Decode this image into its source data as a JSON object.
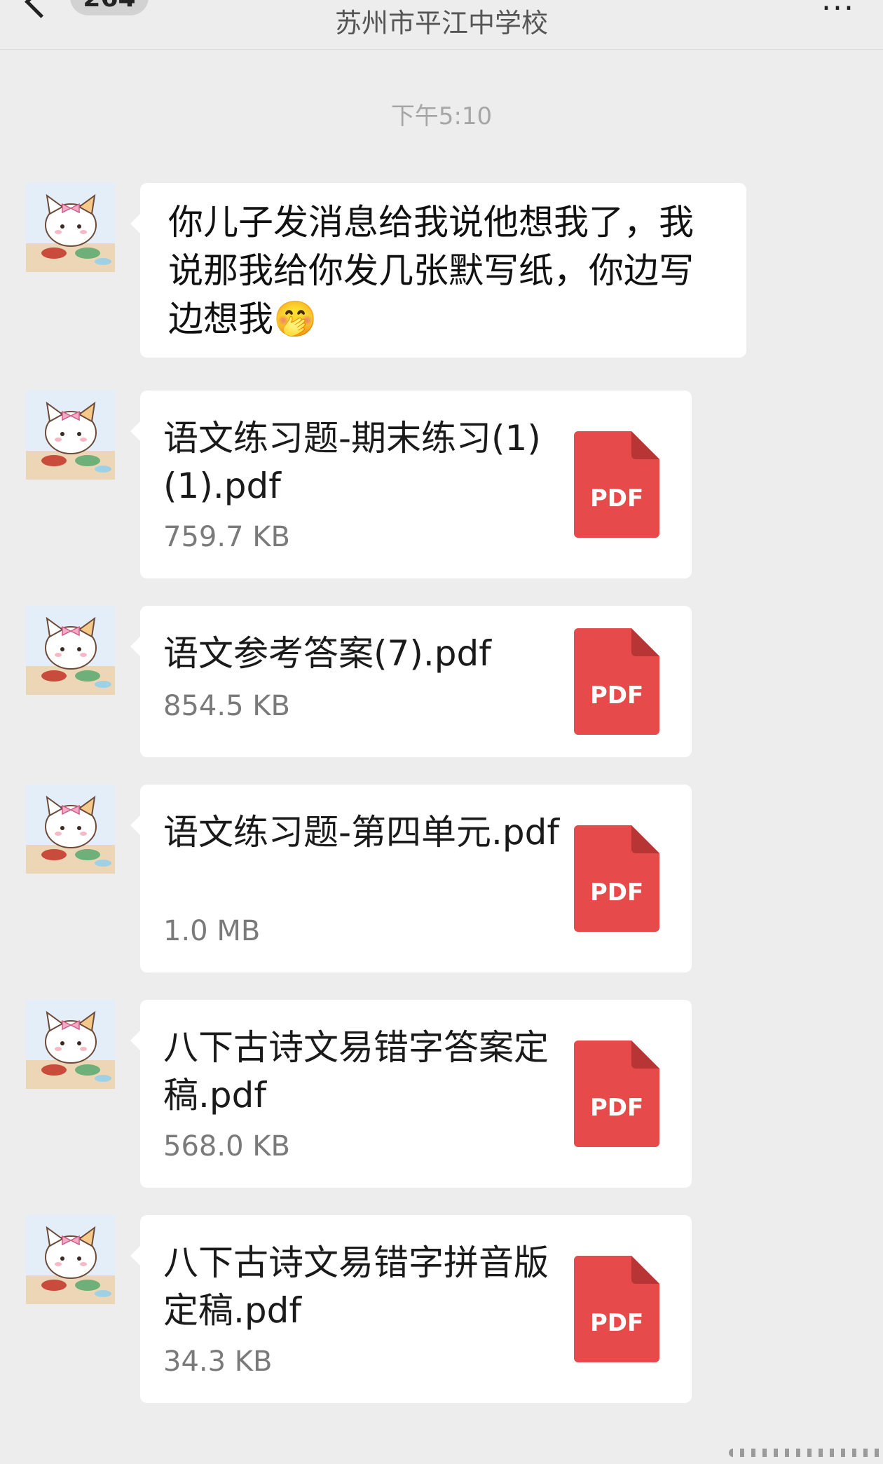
{
  "header": {
    "back_badge": "264",
    "title": "苏州市平江中学校",
    "more_label": "..."
  },
  "timestamp": "下午5:10",
  "messages": [
    {
      "type": "text",
      "text": "你儿子发消息给我说他想我了，我说那我给你发几张默写纸，你边写边想我",
      "emoji": "🤭"
    },
    {
      "type": "file",
      "name": "语文练习题-期末练习(1)(1).pdf",
      "size": "759.7 KB",
      "icon_label": "PDF"
    },
    {
      "type": "file",
      "name": "语文参考答案(7).pdf",
      "size": "854.5 KB",
      "icon_label": "PDF"
    },
    {
      "type": "file",
      "name": "语文练习题-第四单元.pdf",
      "size": "1.0 MB",
      "icon_label": "PDF"
    },
    {
      "type": "file",
      "name": "八下古诗文易错字答案定稿.pdf",
      "size": "568.0 KB",
      "icon_label": "PDF"
    },
    {
      "type": "file",
      "name": "八下古诗文易错字拼音版定稿.pdf",
      "size": "34.3 KB",
      "icon_label": "PDF"
    }
  ],
  "colors": {
    "background": "#ededed",
    "bubble": "#ffffff",
    "pdf_red": "#e64a4a",
    "timestamp": "#a6a6a6"
  }
}
